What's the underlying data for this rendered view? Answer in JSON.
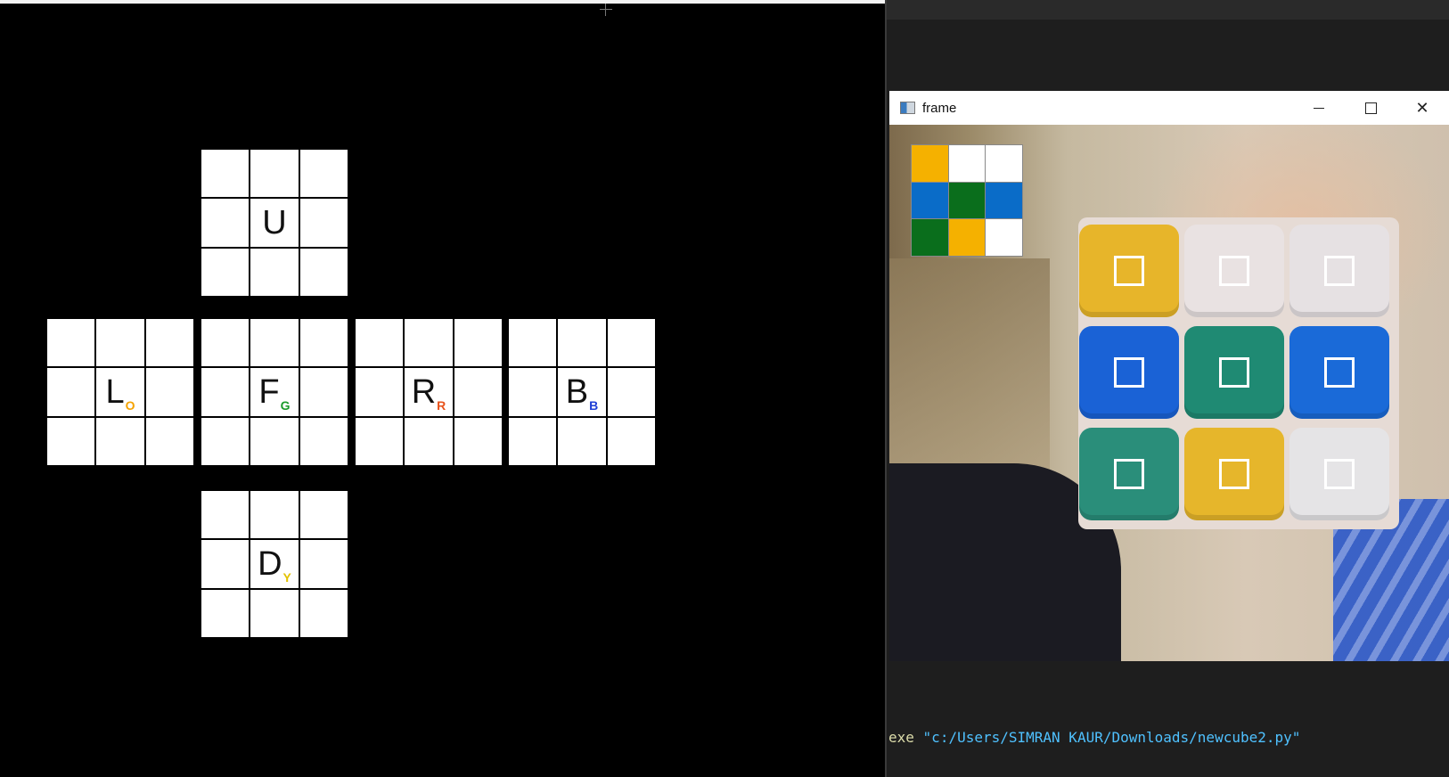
{
  "cube_map": {
    "faces": [
      {
        "id": "U",
        "letter": "U",
        "sub": "",
        "sub_color": "#000000"
      },
      {
        "id": "L",
        "letter": "L",
        "sub": "O",
        "sub_color": "#f5a300"
      },
      {
        "id": "F",
        "letter": "F",
        "sub": "G",
        "sub_color": "#1a9a2a"
      },
      {
        "id": "R",
        "letter": "R",
        "sub": "R",
        "sub_color": "#e8531c"
      },
      {
        "id": "B",
        "letter": "B",
        "sub": "B",
        "sub_color": "#1f3fd6"
      },
      {
        "id": "D",
        "letter": "D",
        "sub": "Y",
        "sub_color": "#e3c200"
      }
    ]
  },
  "frame_window": {
    "title": "frame",
    "controls": [
      "minimize",
      "maximize",
      "close"
    ],
    "preview_colors": [
      "#f5b100",
      "#ffffff",
      "#ffffff",
      "#0a6cc8",
      "#0a6e1c",
      "#0a6cc8",
      "#0a6e1c",
      "#f5b100",
      "#ffffff"
    ],
    "camera_stickers": [
      "#e7b52a",
      "#e9e2e2",
      "#e6e1e3",
      "#1a62d6",
      "#1f8a73",
      "#1a6ad8",
      "#2a8e7a",
      "#e6b62b",
      "#e5e4e6"
    ]
  },
  "editor": {
    "terminal_exe": "exe",
    "terminal_path": "\"c:/Users/SIMRAN KAUR/Downloads/newcube2.py\""
  }
}
